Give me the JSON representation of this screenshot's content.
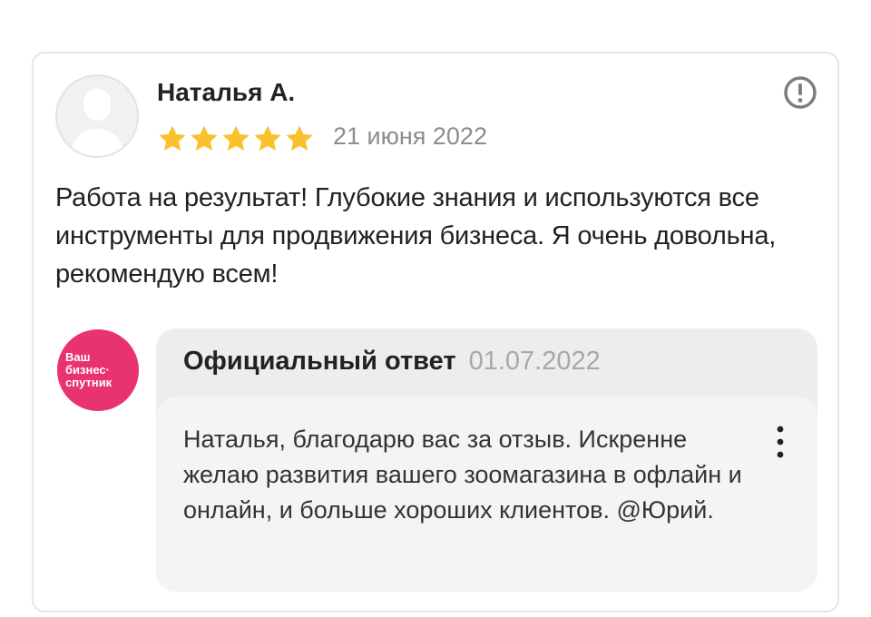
{
  "review": {
    "author": "Наталья А.",
    "rating": 5,
    "rating_max": 5,
    "date": "21 июня 2022",
    "text": "Работа на результат! Глубокие знания и используются все инструменты для продвижения бизнеса. Я очень довольна, рекомендую всем!",
    "report_icon": "exclamation-circle-icon",
    "star_color": "#fbc02d"
  },
  "reply": {
    "logo_text": "Ваш\nбизнес·\nспутник",
    "logo_color": "#e8336f",
    "title": "Официальный ответ",
    "date": "01.07.2022",
    "text": "Наталья, благодарю вас за отзыв. Искренне желаю развития вашего зоомагазина в офлайн и онлайн, и больше хороших клиентов. @Юрий.",
    "menu_icon": "more-vertical-icon"
  }
}
